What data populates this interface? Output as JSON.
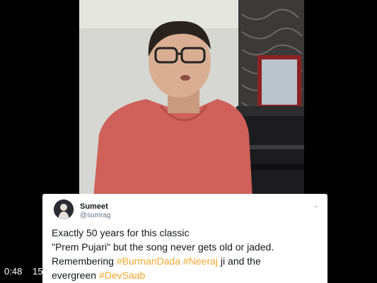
{
  "player": {
    "time_current": "0:48",
    "time_total": "15"
  },
  "tweet": {
    "display_name": "Sumeet",
    "handle": "@sumrag",
    "text_line1": "Exactly 50 years for this classic",
    "text_line2": "\"Prem Pujari\" but the song never gets old or jaded.",
    "text_line3_prefix": "Remembering ",
    "hashtag_burmandada": "#BurmanDada",
    "hashtag_neeraj": "#Neeraj",
    "text_line3_suffix": " ji and the",
    "text_line4_prefix": "evergreen ",
    "hashtag_devsaab": "#DevSaab",
    "hashtag_color": "#f0a830",
    "caret_icon": "chevron-down-icon"
  }
}
